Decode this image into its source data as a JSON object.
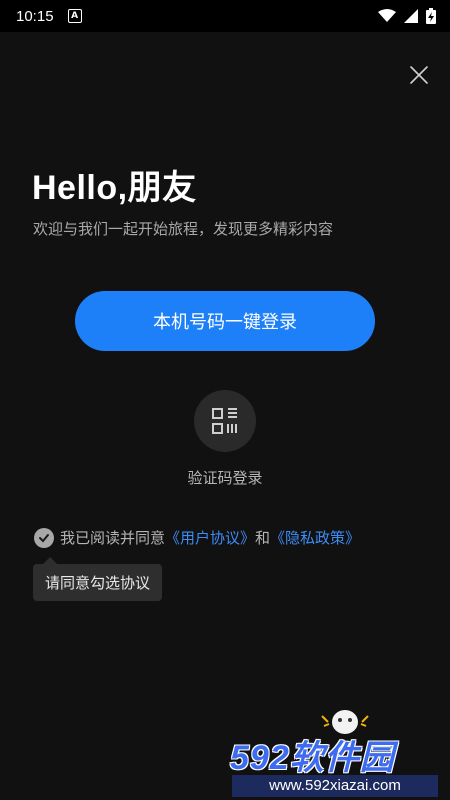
{
  "status_bar": {
    "time": "10:15",
    "notification_icon_letter": "A",
    "icons": [
      "wifi-icon",
      "signal-icon",
      "battery-charging-icon"
    ]
  },
  "header": {
    "close_icon": "close-icon"
  },
  "greeting": {
    "title": "Hello,朋友",
    "subtitle": "欢迎与我们一起开始旅程，发现更多精彩内容"
  },
  "primary_login": {
    "label": "本机号码一键登录",
    "color": "#1e80f8"
  },
  "alt_login": {
    "icon": "sms-code-icon",
    "label": "验证码登录"
  },
  "agreement": {
    "prefix": "我已阅读并同意",
    "user_agreement": "《用户协议》",
    "and": "和",
    "privacy_policy": "《隐私政策》",
    "link_color": "#3d8cf5"
  },
  "toast": {
    "text": "请同意勾选协议"
  },
  "watermark": {
    "brand": "592软件园",
    "url": "www.592xiazai.com"
  }
}
